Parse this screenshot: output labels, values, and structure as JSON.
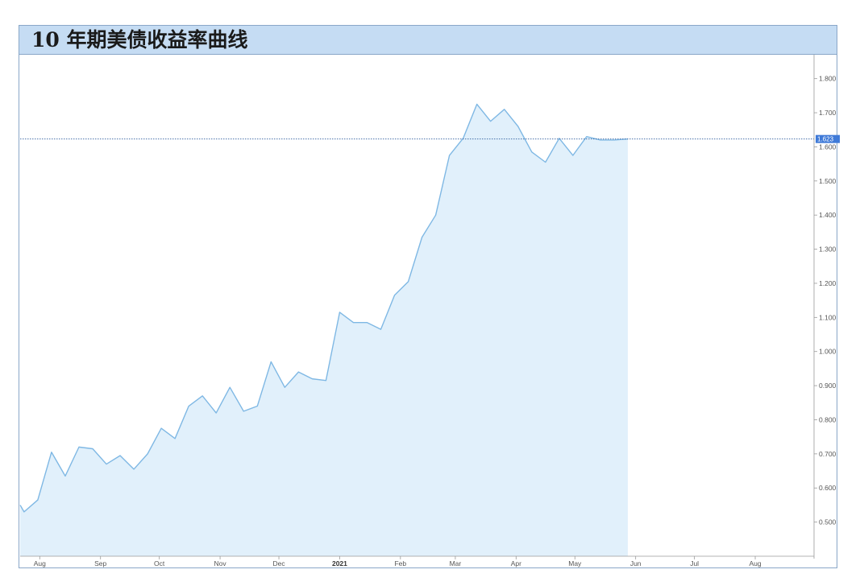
{
  "title": "10 年期美债收益率曲线",
  "colors": {
    "line": "#7fb8e4",
    "area": "#e1f0fb",
    "reference": "#2f5d9e",
    "last_badge": "#3f7ad8",
    "title_bg": "#c5dcf3"
  },
  "chart_data": {
    "type": "area",
    "title": "10 年期美债收益率曲线",
    "xlabel": "",
    "ylabel": "",
    "ylim": [
      0.4,
      1.87
    ],
    "xlim": [
      "2020-07-22",
      "2021-08-31"
    ],
    "y_ticks": [
      0.5,
      0.6,
      0.7,
      0.8,
      0.9,
      1.0,
      1.1,
      1.2,
      1.3,
      1.4,
      1.5,
      1.6,
      1.7,
      1.8
    ],
    "y_tick_labels": [
      "0.500",
      "0.600",
      "0.700",
      "0.800",
      "0.900",
      "1.000",
      "1.100",
      "1.200",
      "1.300",
      "1.400",
      "1.500",
      "1.600",
      "1.700",
      "1.800"
    ],
    "x_ticks": [
      {
        "date": "2020-08-01",
        "label": "Aug",
        "bold": false
      },
      {
        "date": "2020-09-01",
        "label": "Sep",
        "bold": false
      },
      {
        "date": "2020-10-01",
        "label": "Oct",
        "bold": false
      },
      {
        "date": "2020-11-01",
        "label": "Nov",
        "bold": false
      },
      {
        "date": "2020-12-01",
        "label": "Dec",
        "bold": false
      },
      {
        "date": "2021-01-01",
        "label": "2021",
        "bold": true
      },
      {
        "date": "2021-02-01",
        "label": "Feb",
        "bold": false
      },
      {
        "date": "2021-03-01",
        "label": "Mar",
        "bold": false
      },
      {
        "date": "2021-04-01",
        "label": "Apr",
        "bold": false
      },
      {
        "date": "2021-05-01",
        "label": "May",
        "bold": false
      },
      {
        "date": "2021-06-01",
        "label": "Jun",
        "bold": false
      },
      {
        "date": "2021-07-01",
        "label": "Jul",
        "bold": false
      },
      {
        "date": "2021-08-01",
        "label": "Aug",
        "bold": false
      }
    ],
    "last_value": 1.623,
    "last_value_label": "1.623",
    "grid": false,
    "series": [
      {
        "dates": [
          "2020-07-22",
          "2020-07-24",
          "2020-07-31",
          "2020-08-07",
          "2020-08-14",
          "2020-08-21",
          "2020-08-28",
          "2020-09-04",
          "2020-09-11",
          "2020-09-18",
          "2020-09-25",
          "2020-10-02",
          "2020-10-09",
          "2020-10-16",
          "2020-10-23",
          "2020-10-30",
          "2020-11-06",
          "2020-11-13",
          "2020-11-20",
          "2020-11-27",
          "2020-12-04",
          "2020-12-11",
          "2020-12-18",
          "2020-12-25",
          "2021-01-01",
          "2021-01-08",
          "2021-01-15",
          "2021-01-22",
          "2021-01-29",
          "2021-02-05",
          "2021-02-12",
          "2021-02-19",
          "2021-02-26",
          "2021-03-05",
          "2021-03-12",
          "2021-03-19",
          "2021-03-26",
          "2021-04-02",
          "2021-04-09",
          "2021-04-16",
          "2021-04-23",
          "2021-04-30",
          "2021-05-07",
          "2021-05-14",
          "2021-05-21",
          "2021-05-28"
        ],
        "values": [
          0.55,
          0.53,
          0.565,
          0.705,
          0.635,
          0.72,
          0.715,
          0.67,
          0.695,
          0.655,
          0.7,
          0.775,
          0.745,
          0.84,
          0.87,
          0.82,
          0.895,
          0.825,
          0.84,
          0.97,
          0.895,
          0.94,
          0.92,
          0.915,
          1.115,
          1.085,
          1.085,
          1.065,
          1.165,
          1.205,
          1.335,
          1.4,
          1.575,
          1.625,
          1.725,
          1.675,
          1.71,
          1.66,
          1.585,
          1.555,
          1.625,
          1.575,
          1.63,
          1.62,
          1.62,
          1.623
        ]
      }
    ]
  }
}
